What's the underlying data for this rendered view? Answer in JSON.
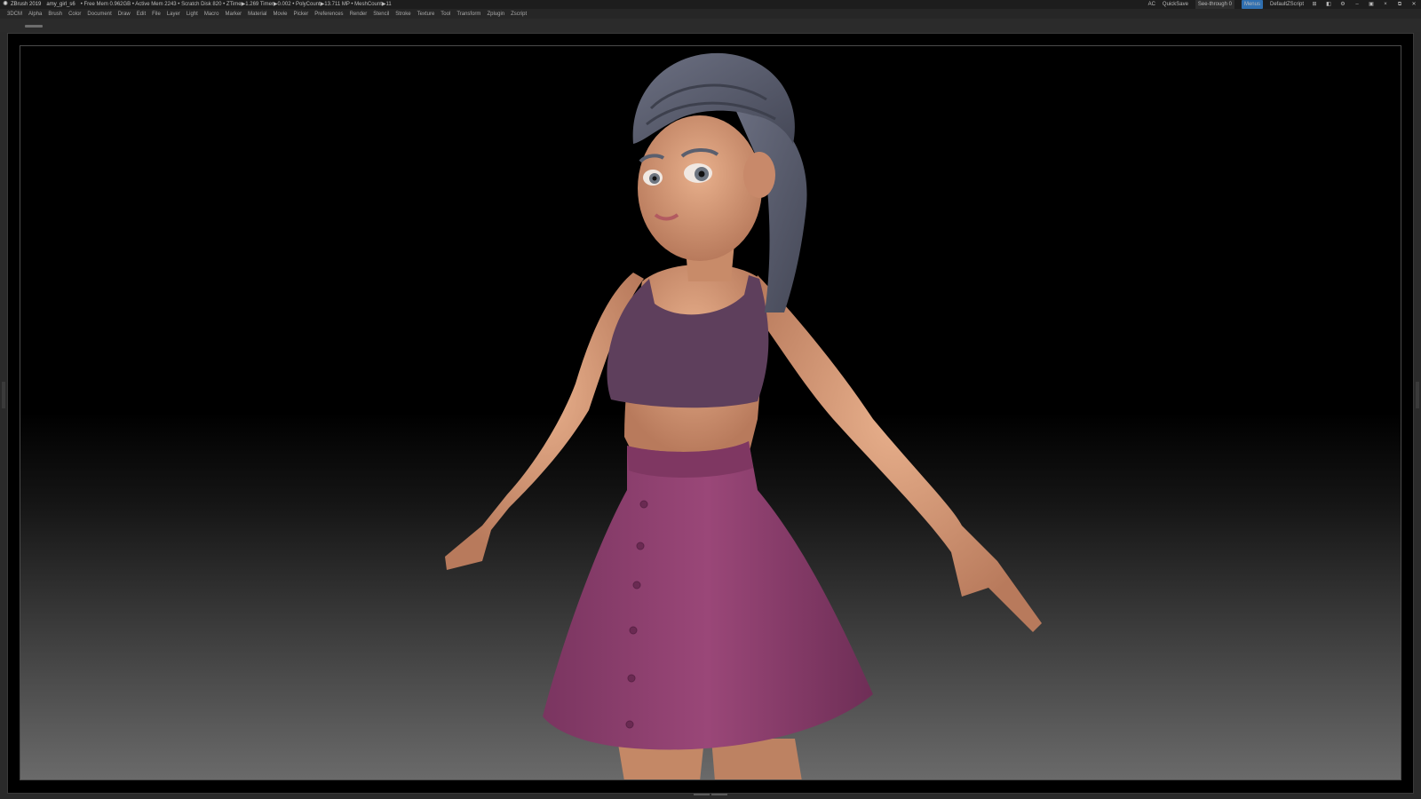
{
  "titlebar": {
    "app_name": "ZBrush 2019",
    "file_name": "amy_girl_s6",
    "stats": "• Free Mem 0.962GB • Active Mem 2243 • Scratch Disk 820 • ZTime▶1.269 Timer▶0.002 • PolyCount▶13.711 MP • MeshCount▶11",
    "ac_label": "AC",
    "quicksave_label": "QuickSave",
    "seethrough_label": "See-through",
    "seethrough_value": "0",
    "menus_label": "Menus",
    "script_label": "DefaultZScript"
  },
  "menubar": {
    "items": [
      "3DCM",
      "Alpha",
      "Brush",
      "Color",
      "Document",
      "Draw",
      "Edit",
      "File",
      "Layer",
      "Light",
      "Macro",
      "Marker",
      "Material",
      "Movie",
      "Picker",
      "Preferences",
      "Render",
      "Stencil",
      "Stroke",
      "Texture",
      "Tool",
      "Transform",
      "Zplugin",
      "Zscript"
    ]
  },
  "colors": {
    "skin": "#d9a07e",
    "hair": "#5a5d6e",
    "top": "#5e3f5c",
    "skirt": "#8e3f6e",
    "highlight_bar": "#e6a517",
    "menus_chip": "#2f6fb0"
  },
  "viewport": {
    "subject": "3d-character-model"
  }
}
